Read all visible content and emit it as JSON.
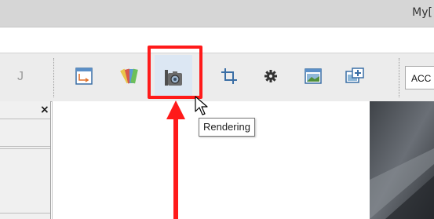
{
  "window": {
    "title_partial": "My["
  },
  "toolbar": {
    "partial_icon_text": "J",
    "buttons": [
      {
        "name": "window-icon"
      },
      {
        "name": "palette-icon"
      },
      {
        "name": "camera-icon",
        "tooltip": "Rendering",
        "state": "hover"
      },
      {
        "name": "crop-icon"
      },
      {
        "name": "gear-icon"
      },
      {
        "name": "image-icon"
      },
      {
        "name": "add-image-icon"
      }
    ],
    "dropdown_value": "ACC"
  },
  "left_panel": {
    "close_label": "×"
  },
  "tooltip": {
    "text": "Rendering"
  },
  "annotation": {
    "highlight_color": "#ff1a1a"
  }
}
